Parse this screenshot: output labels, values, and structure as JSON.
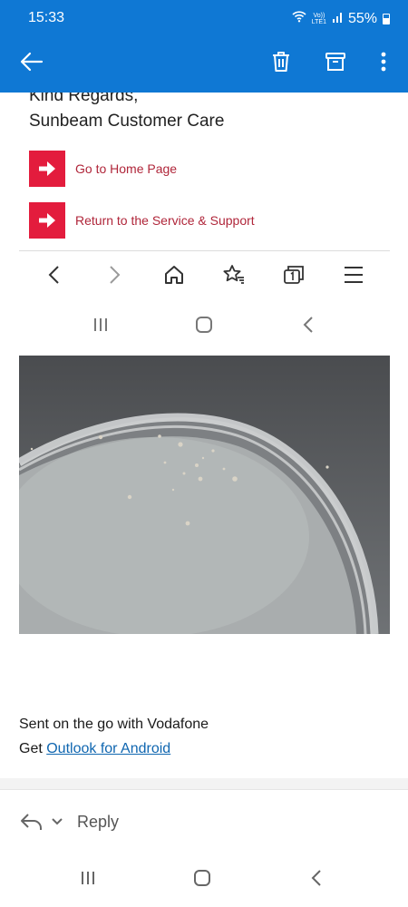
{
  "status": {
    "time": "15:33",
    "network_top": "Vo))",
    "network_bottom": "LTE1",
    "battery": "55%"
  },
  "toolbar": {
    "back_icon": "arrow-left-icon",
    "delete_icon": "trash-icon",
    "archive_icon": "archive-icon",
    "more_icon": "more-vertical-icon"
  },
  "mail": {
    "signoff_line1": "Kind Regards,",
    "signoff_line2": "Sunbeam Customer Care",
    "links": [
      {
        "label": "Go to Home Page"
      },
      {
        "label": "Return to the Service & Support"
      }
    ],
    "signature_line1": "Sent on the go with Vodafone",
    "signature_prefix": "Get ",
    "signature_link": "Outlook for Android"
  },
  "colors": {
    "accent": "#0f78d4",
    "arrow_box": "#e31c3d",
    "link_red": "#b0263a",
    "link_blue": "#0f66b0"
  },
  "reply": {
    "label": "Reply"
  }
}
